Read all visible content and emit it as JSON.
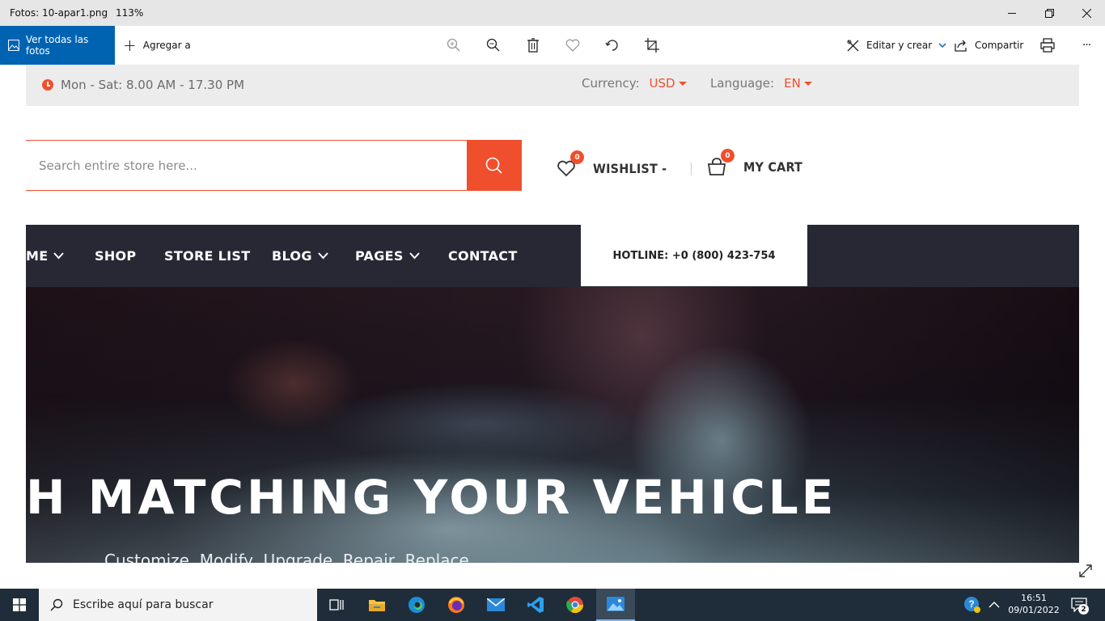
{
  "window": {
    "app_title": "Fotos: 10-apar1.png",
    "zoom": "113%"
  },
  "photos_toolbar": {
    "view_all_label": "Ver todas las fotos",
    "add_to_label": "Agregar a",
    "edit_create_label": "Editar y crear",
    "share_label": "Compartir",
    "more_label": "···"
  },
  "site": {
    "topbar": {
      "hours": "Mon - Sat: 8.00 AM - 17.30 PM",
      "currency_label": "Currency:",
      "currency_value": "USD",
      "language_label": "Language:",
      "language_value": "EN"
    },
    "search": {
      "placeholder": "Search entire store here..."
    },
    "wishlist": {
      "label": "WISHLIST -",
      "count": "0"
    },
    "cart": {
      "label": "MY CART",
      "count": "0"
    },
    "nav": {
      "items": [
        {
          "label": "ME"
        },
        {
          "label": "SHOP"
        },
        {
          "label": "STORE LIST"
        },
        {
          "label": "BLOG"
        },
        {
          "label": "PAGES"
        },
        {
          "label": "CONTACT"
        }
      ],
      "hotline": "HOTLINE: +0 (800) 423-754"
    },
    "hero": {
      "title": "H MATCHING YOUR VEHICLE",
      "subtitle": "Customize, Modify, Upgrade, Repair, Replace"
    },
    "colors": {
      "accent": "#f04f2d",
      "nav_bg": "#272833",
      "topbar_bg": "#ececec"
    }
  },
  "taskbar": {
    "search_placeholder": "Escribe aquí para buscar",
    "time": "16:51",
    "date": "09/01/2022",
    "notification_count": "2",
    "apps": [
      "task-view-icon",
      "file-explorer-icon",
      "edge-icon",
      "firefox-icon",
      "mail-icon",
      "vscode-icon",
      "chrome-icon",
      "photos-icon"
    ]
  }
}
